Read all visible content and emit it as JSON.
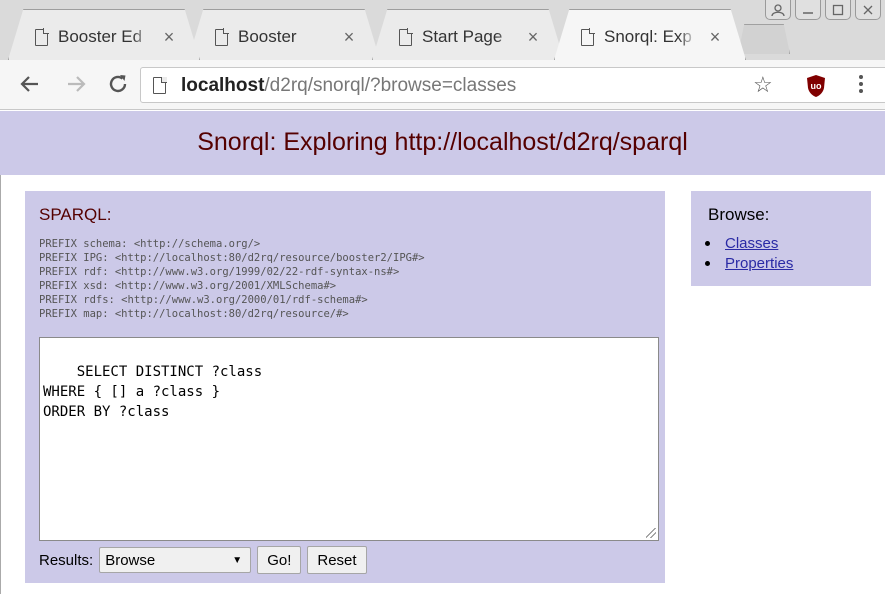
{
  "browser": {
    "tabs": [
      {
        "title": "Booster Ed",
        "active": false
      },
      {
        "title": "Booster",
        "active": false
      },
      {
        "title": "Start Page",
        "active": false
      },
      {
        "title": "Snorql: Exp",
        "active": true
      }
    ],
    "close_glyph": "×",
    "url_host": "localhost",
    "url_path": "/d2rq/snorql/?browse=classes"
  },
  "page": {
    "title": "Snorql: Exploring http://localhost/d2rq/sparql",
    "sparql": {
      "label": "SPARQL:",
      "prefixes": [
        "PREFIX schema: <http://schema.org/>",
        "PREFIX IPG: <http://localhost:80/d2rq/resource/booster2/IPG#>",
        "PREFIX rdf: <http://www.w3.org/1999/02/22-rdf-syntax-ns#>",
        "PREFIX xsd: <http://www.w3.org/2001/XMLSchema#>",
        "PREFIX rdfs: <http://www.w3.org/2000/01/rdf-schema#>",
        "PREFIX map: <http://localhost:80/d2rq/resource/#>"
      ],
      "query": "SELECT DISTINCT ?class\nWHERE { [] a ?class }\nORDER BY ?class",
      "results_label": "Results:",
      "results_selected": "Browse",
      "go_label": "Go!",
      "reset_label": "Reset"
    },
    "browse": {
      "title": "Browse:",
      "links": [
        "Classes",
        "Properties"
      ]
    }
  },
  "colors": {
    "panel_bg": "#ccc9e8",
    "title_text": "#550000",
    "link": "#2a2aa5"
  }
}
